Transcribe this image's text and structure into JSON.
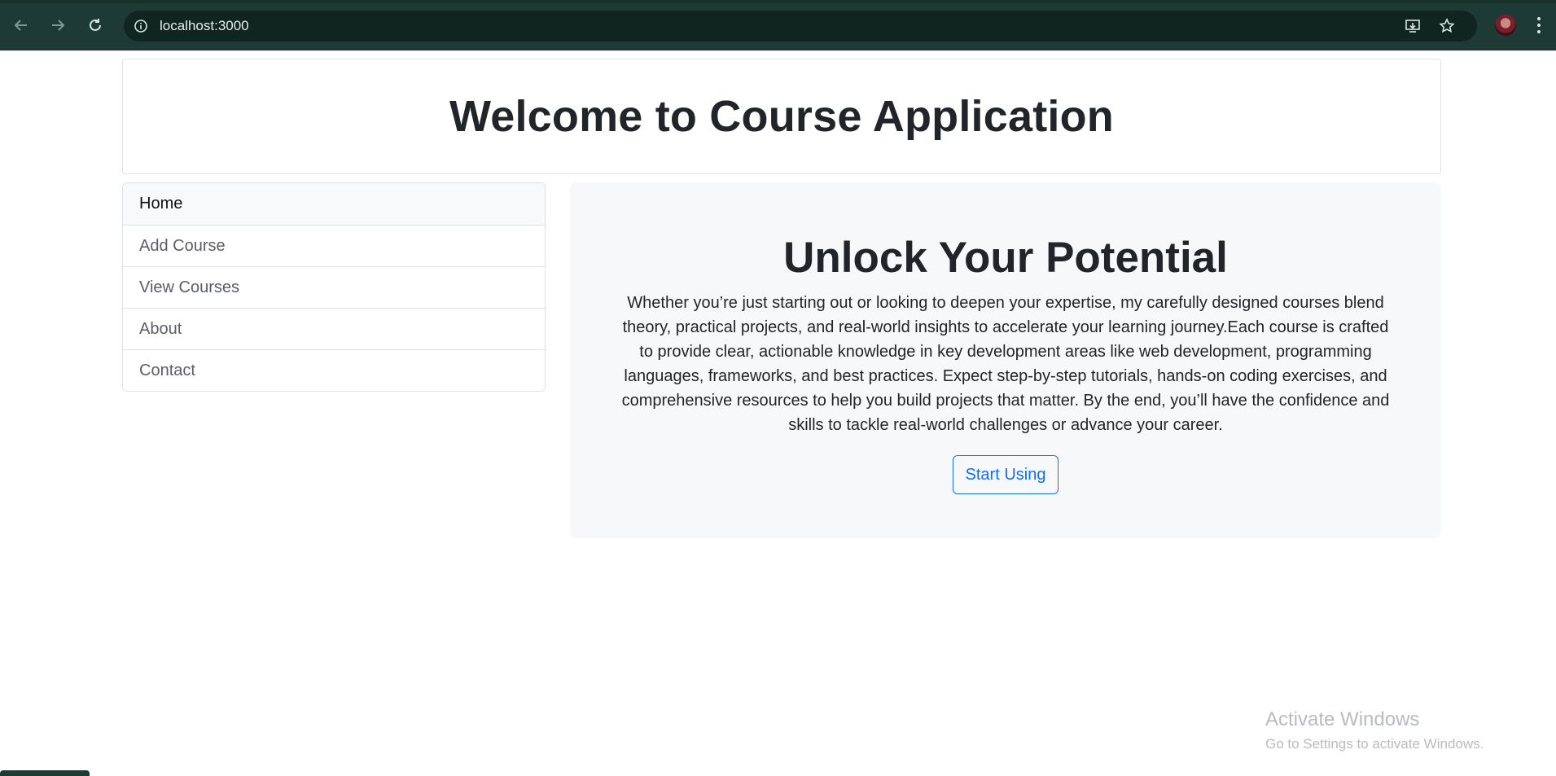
{
  "browser": {
    "url": "localhost:3000",
    "icons": {
      "back": "arrow-left-icon",
      "forward": "arrow-right-icon",
      "reload": "reload-icon",
      "site_info": "info-icon",
      "install": "install-app-icon",
      "bookmark": "star-icon",
      "profile": "avatar",
      "menu": "more-vertical-icon"
    }
  },
  "header": {
    "title": "Welcome to Course Application"
  },
  "sidebar": {
    "items": [
      {
        "label": "Home",
        "active": true
      },
      {
        "label": "Add Course",
        "active": false
      },
      {
        "label": "View Courses",
        "active": false
      },
      {
        "label": "About",
        "active": false
      },
      {
        "label": "Contact",
        "active": false
      }
    ]
  },
  "hero": {
    "title": "Unlock Your Potential",
    "text": "Whether you’re just starting out or looking to deepen your expertise, my carefully designed courses blend theory, practical projects, and real-world insights to accelerate your learning journey.Each course is crafted to provide clear, actionable knowledge in key development areas like web development, programming languages, frameworks, and best practices. Expect step-by-step tutorials, hands-on coding exercises, and comprehensive resources to help you build projects that matter. By the end, you’ll have the confidence and skills to tackle real-world challenges or advance your career.",
    "button_label": "Start Using"
  },
  "watermark": {
    "title": "Activate Windows",
    "subtitle": "Go to Settings to activate Windows."
  },
  "colors": {
    "chrome_bg": "#1e3a34",
    "omnibox_bg": "#10251f",
    "accent": "#0d6efd",
    "border": "#dee2e6",
    "hero_bg": "#f7f8f9"
  }
}
